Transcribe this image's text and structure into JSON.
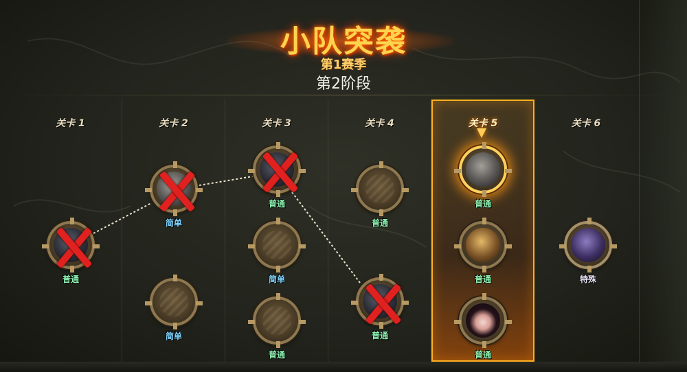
{
  "header": {
    "title": "小队突袭",
    "season": "第1赛季",
    "stage": "第2阶段"
  },
  "columns": [
    {
      "label": "关卡 1"
    },
    {
      "label": "关卡 2"
    },
    {
      "label": "关卡 3"
    },
    {
      "label": "关卡 4"
    },
    {
      "label": "关卡 5",
      "state": "current"
    },
    {
      "label": "关卡 6"
    }
  ],
  "nodes": {
    "c1n1": {
      "label": "普通",
      "state": "defeated",
      "icon": "dark-warrior-portrait"
    },
    "c2n1": {
      "label": "简单",
      "state": "defeated",
      "icon": "teal-armored-portrait"
    },
    "c2n2": {
      "label": "简单",
      "state": "locked",
      "icon": "locked-emblem"
    },
    "c3n1": {
      "label": "普通",
      "state": "defeated",
      "icon": "spiked-helmet-portrait"
    },
    "c3n2": {
      "label": "简单",
      "state": "locked",
      "icon": "locked-emblem"
    },
    "c3n3": {
      "label": "普通",
      "state": "locked",
      "icon": "locked-emblem"
    },
    "c4n1": {
      "label": "普通",
      "state": "locked",
      "icon": "locked-emblem"
    },
    "c4n2": {
      "label": "普通",
      "state": "defeated",
      "icon": "dark-warrior-portrait"
    },
    "c5n1": {
      "label": "普通",
      "state": "selected",
      "icon": "stone-golem-portrait"
    },
    "c5n2": {
      "label": "普通",
      "state": "available",
      "icon": "gold-armor-portrait"
    },
    "c5n3": {
      "label": "普通",
      "state": "available",
      "icon": "dark-hair-girl-portrait"
    },
    "c6n1": {
      "label": "特殊",
      "state": "boss",
      "icon": "purple-armor-portrait"
    }
  },
  "colors": {
    "accent": "#ffb020",
    "defeated_cross": "#e0211f",
    "label_normal": "#8df0b0",
    "label_easy": "#7fd4ff"
  }
}
